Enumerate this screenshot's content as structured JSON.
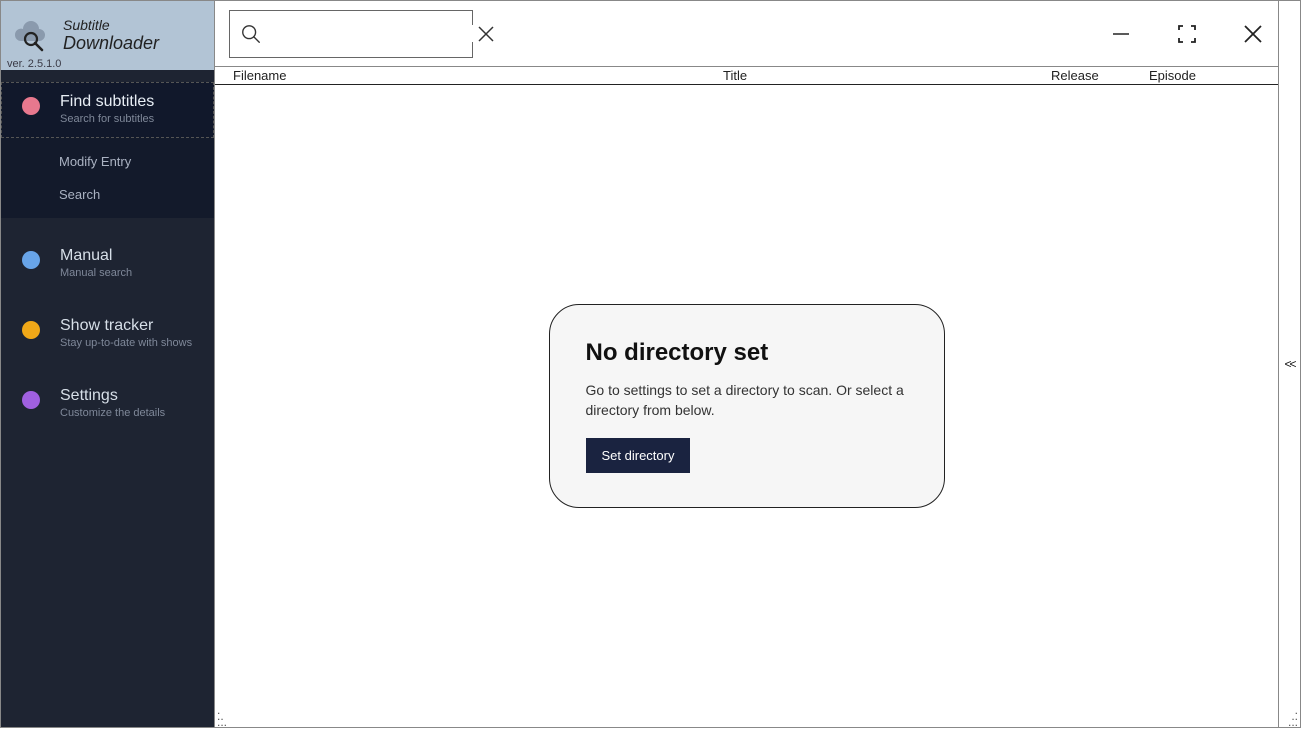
{
  "brand": {
    "line1": "Subtitle",
    "line2": "Downloader",
    "version": "ver. 2.5.1.0"
  },
  "sidebar": {
    "items": [
      {
        "title": "Find subtitles",
        "sub": "Search for subtitles",
        "dot_color": "#e8788e"
      },
      {
        "title": "Manual",
        "sub": "Manual search",
        "dot_color": "#68a4e8"
      },
      {
        "title": "Show tracker",
        "sub": "Stay up-to-date with shows",
        "dot_color": "#f0a818"
      },
      {
        "title": "Settings",
        "sub": "Customize the details",
        "dot_color": "#a060e0"
      }
    ],
    "subnav": [
      "Modify Entry",
      "Search"
    ]
  },
  "search": {
    "value": "",
    "placeholder": ""
  },
  "columns": {
    "filename": "Filename",
    "title": "Title",
    "release": "Release",
    "episode": "Episode"
  },
  "placeholder": {
    "title": "No directory set",
    "text": "Go to settings to set a directory to scan. Or select a directory from below.",
    "button": "Set directory"
  },
  "right_strip": {
    "collapse": "<<"
  }
}
